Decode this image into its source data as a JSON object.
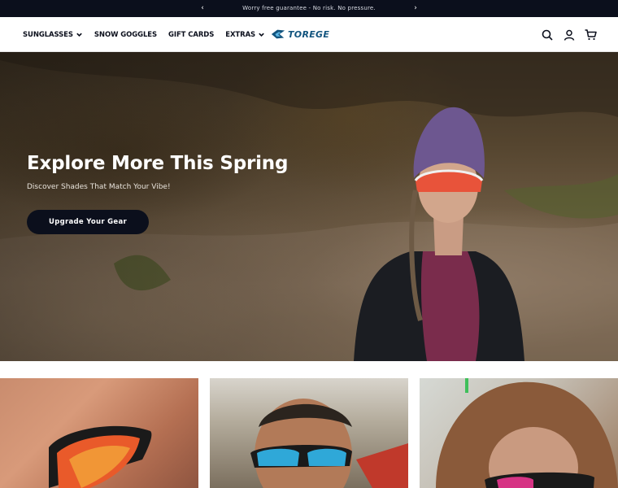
{
  "announcement": {
    "text": "Worry free guarantee - No risk. No pressure.",
    "prev_glyph": "‹",
    "next_glyph": "›"
  },
  "nav": {
    "items": [
      {
        "label": "SUNGLASSES",
        "has_dropdown": true
      },
      {
        "label": "SNOW GOGGLES",
        "has_dropdown": false
      },
      {
        "label": "GIFT CARDS",
        "has_dropdown": false
      },
      {
        "label": "EXTRAS",
        "has_dropdown": true
      }
    ]
  },
  "brand": {
    "name": "TOREGE",
    "color": "#12547e"
  },
  "header_icons": [
    "search-icon",
    "account-icon",
    "cart-icon"
  ],
  "hero": {
    "title": "Explore More This Spring",
    "subtitle": "Discover Shades That Match Your Vibe!",
    "cta_label": "Upgrade Your Gear"
  },
  "colors": {
    "dark": "#0b0f1c",
    "accent_lens": "#e8533a"
  }
}
